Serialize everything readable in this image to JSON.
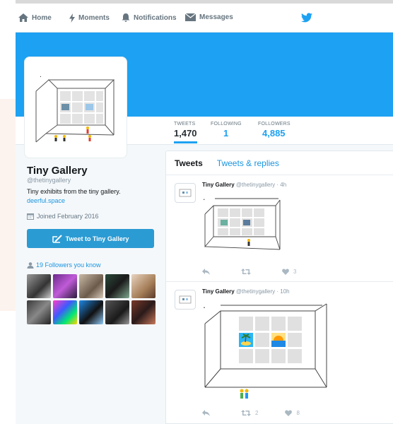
{
  "nav": {
    "home": "Home",
    "moments": "Moments",
    "notifications": "Notifications",
    "messages": "Messages",
    "brand_icon": "twitter-bird-icon"
  },
  "colors": {
    "accent": "#1da1f2",
    "link": "#1b95e0",
    "button": "#2b9bd3"
  },
  "profile": {
    "name": "Tiny Gallery",
    "handle": "@thetinygallery",
    "bio": "Tiny exhibits from the tiny gallery.",
    "link": "deerful.space",
    "joined": "Joined February 2016",
    "tweet_to": "Tweet to Tiny Gallery",
    "followers_you_know": "19 Followers you know"
  },
  "stats": [
    {
      "label": "TWEETS",
      "value": "1,470"
    },
    {
      "label": "FOLLOWING",
      "value": "1"
    },
    {
      "label": "FOLLOWERS",
      "value": "4,885"
    }
  ],
  "timeline": {
    "tabs": [
      "Tweets",
      "Tweets & replies"
    ],
    "tweets": [
      {
        "name": "Tiny Gallery",
        "meta": "@thetinygallery · 4h",
        "retweets": "",
        "likes": "3"
      },
      {
        "name": "Tiny Gallery",
        "meta": "@thetinygallery · 10h",
        "retweets": "2",
        "likes": "8"
      }
    ]
  }
}
